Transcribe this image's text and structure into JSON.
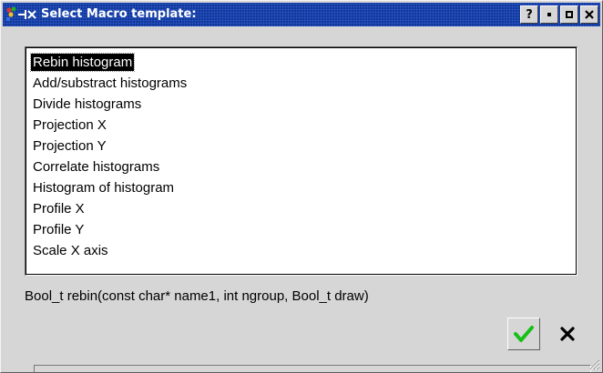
{
  "window": {
    "title": "Select Macro template:",
    "help_label": "?"
  },
  "templates": [
    "Rebin histogram",
    "Add/substract histograms",
    "Divide histograms",
    "Projection X",
    "Projection Y",
    "Correlate histograms",
    "Histogram of histogram",
    "Profile X",
    "Profile Y",
    "Scale X axis"
  ],
  "selected_index": 0,
  "signature": "Bool_t rebin(const char* name1, int ngroup, Bool_t draw)",
  "colors": {
    "titlebar": "#13389a",
    "ok_check": "#16c016"
  },
  "icons": {
    "app": "root-app-icon",
    "ok": "checkmark-icon",
    "cancel": "close-x-icon"
  }
}
